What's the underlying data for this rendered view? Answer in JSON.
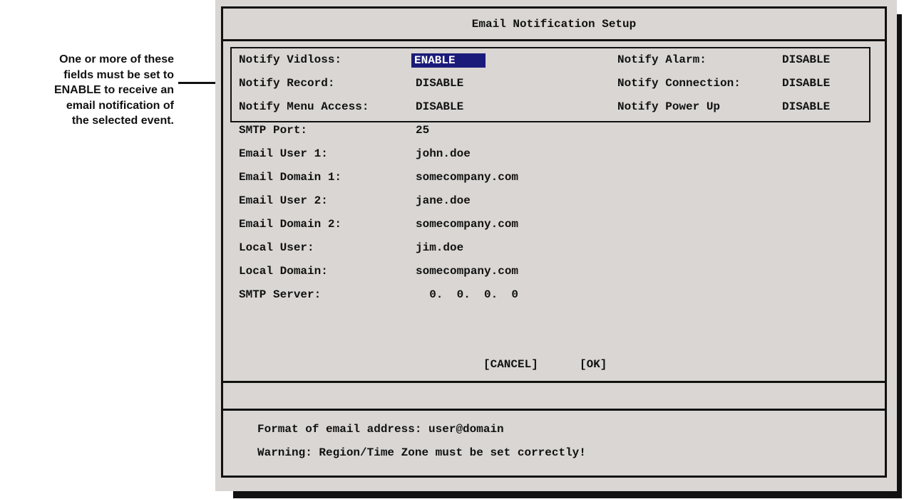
{
  "callout": {
    "lines": [
      "One or more of these",
      "fields must be set to",
      "ENABLE to receive an",
      "email notification of",
      "the selected event."
    ]
  },
  "dialog": {
    "title": "Email Notification Setup",
    "notify": {
      "vidloss": {
        "label": "Notify Vidloss:",
        "value": "ENABLE"
      },
      "alarm": {
        "label": "Notify Alarm:",
        "value": "DISABLE"
      },
      "record": {
        "label": "Notify Record:",
        "value": "DISABLE"
      },
      "connection": {
        "label": "Notify Connection:",
        "value": "DISABLE"
      },
      "menu_access": {
        "label": "Notify Menu Access:",
        "value": "DISABLE"
      },
      "power_up": {
        "label": "Notify Power Up",
        "value": "DISABLE"
      }
    },
    "fields": {
      "smtp_port": {
        "label": "SMTP Port:",
        "value": "25"
      },
      "email_user_1": {
        "label": "Email User 1:",
        "value": "john.doe"
      },
      "email_domain_1": {
        "label": "Email Domain 1:",
        "value": "somecompany.com"
      },
      "email_user_2": {
        "label": "Email User 2:",
        "value": "jane.doe"
      },
      "email_domain_2": {
        "label": "Email Domain 2:",
        "value": "somecompany.com"
      },
      "local_user": {
        "label": "Local User:",
        "value": "jim.doe"
      },
      "local_domain": {
        "label": "Local Domain:",
        "value": "somecompany.com"
      },
      "smtp_server": {
        "label": "SMTP Server:",
        "value": "  0.  0.  0.  0"
      }
    },
    "buttons": {
      "cancel": "[CANCEL]",
      "ok": "[OK]"
    },
    "footer": {
      "format": "Format of email address: user@domain",
      "warning": "Warning: Region/Time Zone must be set correctly!"
    }
  },
  "colors": {
    "panel": "#d9d6d3",
    "selection": "#1a1a7a",
    "ink": "#111111"
  }
}
